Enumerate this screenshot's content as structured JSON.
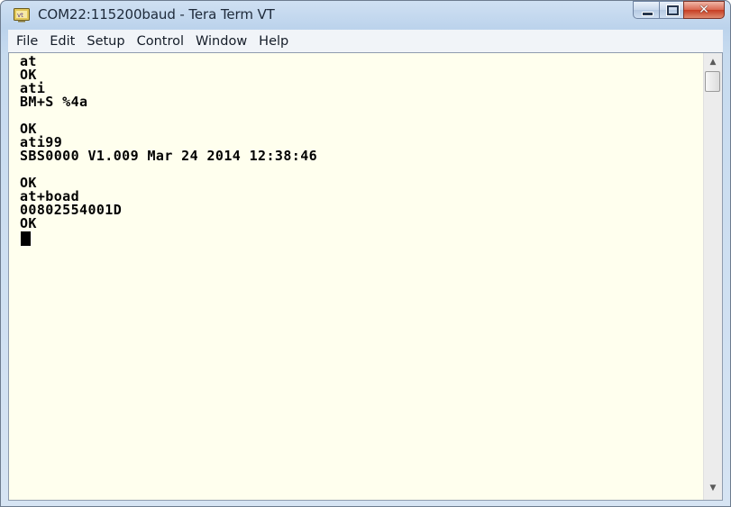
{
  "window": {
    "title": "COM22:115200baud - Tera Term VT",
    "app_icon": "teraterm-icon",
    "close_glyph": "✕"
  },
  "menubar": {
    "items": [
      {
        "label": "File"
      },
      {
        "label": "Edit"
      },
      {
        "label": "Setup"
      },
      {
        "label": "Control"
      },
      {
        "label": "Window"
      },
      {
        "label": "Help"
      }
    ]
  },
  "terminal": {
    "background": "#ffffee",
    "lines": [
      "at",
      "OK",
      "ati",
      "BM+S %4a",
      "",
      "OK",
      "ati99",
      "SBS0000 V1.009 Mar 24 2014 12:38:46",
      "",
      "OK",
      "at+boad",
      "00802554001D",
      "OK"
    ]
  },
  "scrollbar": {
    "up_arrow": "▲",
    "down_arrow": "▼"
  }
}
